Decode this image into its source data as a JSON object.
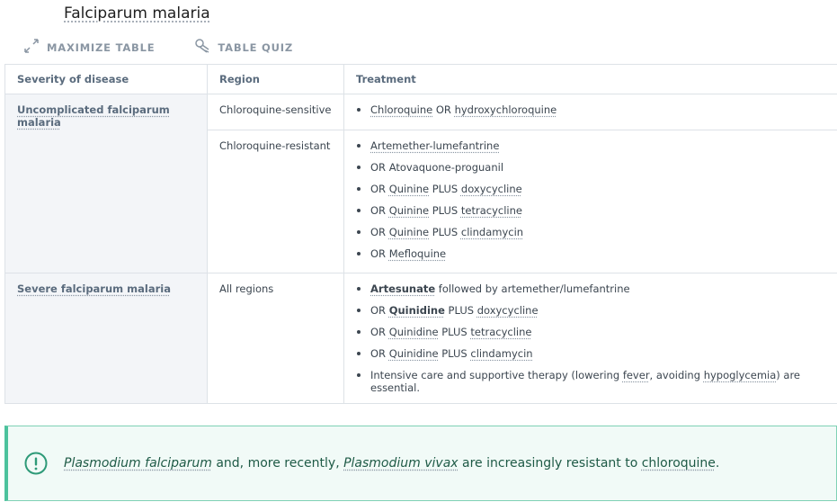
{
  "header": {
    "title": "Falciparum malaria"
  },
  "toolbar": {
    "maximize_label": "MAXIMIZE TABLE",
    "quiz_label": "TABLE QUIZ"
  },
  "table": {
    "columns": [
      "Severity of disease",
      "Region",
      "Treatment"
    ],
    "rows": [
      {
        "severity": "Uncomplicated falciparum malaria",
        "region": "Chloroquine-sensitive",
        "treatments": [
          {
            "parts": [
              {
                "t": "Chloroquine",
                "link": true
              },
              {
                "t": " OR "
              },
              {
                "t": "hydroxychloroquine",
                "link": true
              }
            ]
          }
        ]
      },
      {
        "severity": "",
        "region": "Chloroquine-resistant",
        "treatments": [
          {
            "parts": [
              {
                "t": "Artemether-lumefantrine",
                "link": true
              }
            ]
          },
          {
            "parts": [
              {
                "t": "OR Atovaquone-proguanil"
              }
            ]
          },
          {
            "parts": [
              {
                "t": "OR "
              },
              {
                "t": "Quinine",
                "link": true
              },
              {
                "t": " PLUS "
              },
              {
                "t": "doxycycline",
                "link": true
              }
            ]
          },
          {
            "parts": [
              {
                "t": "OR "
              },
              {
                "t": "Quinine",
                "link": true
              },
              {
                "t": " PLUS "
              },
              {
                "t": "tetracycline",
                "link": true
              }
            ]
          },
          {
            "parts": [
              {
                "t": "OR "
              },
              {
                "t": "Quinine",
                "link": true
              },
              {
                "t": " PLUS "
              },
              {
                "t": "clindamycin",
                "link": true
              }
            ]
          },
          {
            "parts": [
              {
                "t": "OR "
              },
              {
                "t": "Mefloquine",
                "link": true
              }
            ]
          }
        ]
      },
      {
        "severity": "Severe falciparum malaria",
        "region": "All regions",
        "treatments": [
          {
            "parts": [
              {
                "t": "Artesunate",
                "link": true,
                "bold": true
              },
              {
                "t": " followed by artemether/lumefantrine"
              }
            ]
          },
          {
            "parts": [
              {
                "t": "OR "
              },
              {
                "t": "Quinidine",
                "link": true,
                "bold": true
              },
              {
                "t": " PLUS "
              },
              {
                "t": "doxycycline",
                "link": true
              }
            ]
          },
          {
            "parts": [
              {
                "t": "OR "
              },
              {
                "t": "Quinidine",
                "link": true
              },
              {
                "t": " PLUS "
              },
              {
                "t": "tetracycline",
                "link": true
              }
            ]
          },
          {
            "parts": [
              {
                "t": "OR "
              },
              {
                "t": "Quinidine",
                "link": true
              },
              {
                "t": " PLUS "
              },
              {
                "t": "clindamycin",
                "link": true
              }
            ]
          },
          {
            "parts": [
              {
                "t": "Intensive care and supportive therapy (lowering "
              },
              {
                "t": "fever",
                "link": true
              },
              {
                "t": ", avoiding "
              },
              {
                "t": "hypoglycemia",
                "link": true
              },
              {
                "t": ") are essential."
              }
            ]
          }
        ]
      }
    ]
  },
  "note": {
    "parts": [
      {
        "t": "Plasmodium falciparum",
        "italic": true,
        "link": true
      },
      {
        "t": " and, more recently, "
      },
      {
        "t": "Plasmodium vivax",
        "italic": true,
        "link": true
      },
      {
        "t": " are increasingly resistant to "
      },
      {
        "t": "chloroquine",
        "link": true
      },
      {
        "t": "."
      }
    ]
  },
  "colors": {
    "accent": "#4cc29d",
    "note_bg": "#f1faf7",
    "header_text": "#5a6b7d"
  },
  "icons": {
    "maximize": "expand-arrows-icon",
    "quiz": "pill-quiz-icon",
    "note": "exclamation-circle-icon"
  }
}
